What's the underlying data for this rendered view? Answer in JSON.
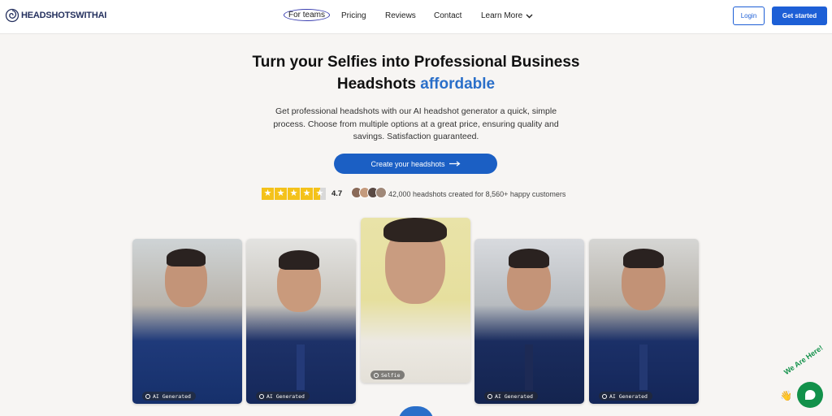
{
  "brand": {
    "name": "HEADSHOTSWITHAI",
    "logo_icon": "spiral-logo-icon"
  },
  "nav": {
    "items": [
      {
        "label": "For teams",
        "active": true
      },
      {
        "label": "Pricing"
      },
      {
        "label": "Reviews"
      },
      {
        "label": "Contact"
      },
      {
        "label": "Learn More",
        "has_dropdown": true
      }
    ],
    "login_label": "Login",
    "get_started_label": "Get started"
  },
  "hero": {
    "title_line1": "Turn your Selfies into Professional Business",
    "title_line2_prefix": "Headshots ",
    "title_line2_accent": "affordable",
    "subtitle": "Get professional headshots with our AI headshot generator a quick, simple process. Choose from multiple options at a great price, ensuring quality and savings. Satisfaction guaranteed.",
    "cta_label": "Create your headshots",
    "cta_icon": "arrow-right-icon"
  },
  "social_proof": {
    "rating": "4.7",
    "stars": 4.5,
    "stat_text": "42,000 headshots created for 8,560+ happy customers"
  },
  "gallery": [
    {
      "tag": "AI Generated"
    },
    {
      "tag": "AI Generated"
    },
    {
      "tag": "Selfie"
    },
    {
      "tag": "AI Generated"
    },
    {
      "tag": "AI Generated"
    }
  ],
  "chat": {
    "label": "We Are Here!",
    "icon": "chat-bubble-icon"
  },
  "colors": {
    "primary": "#1d5fd6",
    "accent_text": "#2a6fc9",
    "chat": "#12914a",
    "star": "#f4c21a"
  }
}
